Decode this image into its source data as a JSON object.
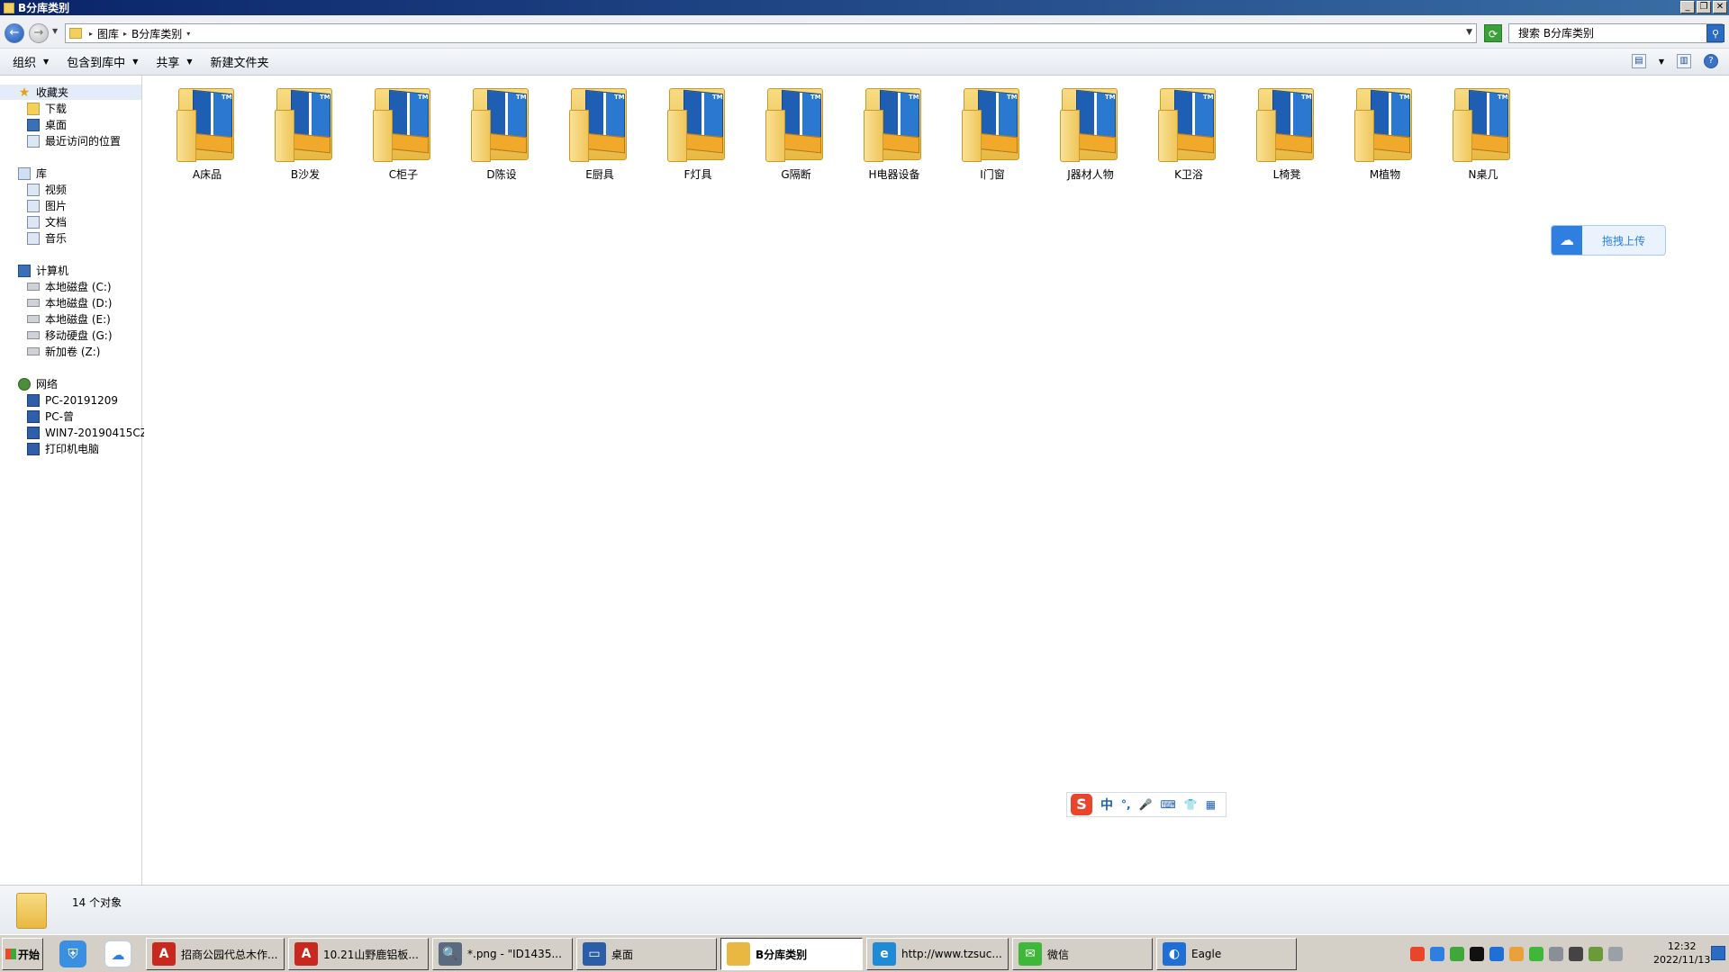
{
  "window": {
    "title": "B分库类别"
  },
  "address": {
    "crumbs": [
      "图库",
      "B分库类别"
    ],
    "search_placeholder": "搜索 B分库类别"
  },
  "toolbar": {
    "organize": "组织",
    "include_in_library": "包含到库中",
    "share": "共享",
    "new_folder": "新建文件夹"
  },
  "nav": {
    "favorites": "收藏夹",
    "favorites_items": [
      "下载",
      "桌面",
      "最近访问的位置"
    ],
    "library": "库",
    "library_items": [
      "视频",
      "图片",
      "文档",
      "音乐"
    ],
    "computer": "计算机",
    "computer_items": [
      "本地磁盘 (C:)",
      "本地磁盘 (D:)",
      "本地磁盘 (E:)",
      "移动硬盘 (G:)",
      "新加卷 (Z:)"
    ],
    "network": "网络",
    "network_items": [
      "PC-20191209",
      "PC-曾",
      "WIN7-20190415CZ",
      "打印机电脑"
    ]
  },
  "folders": [
    "A床品",
    "B沙发",
    "C柜子",
    "D陈设",
    "E厨具",
    "F灯具",
    "G隔断",
    "H电器设备",
    "I门窗",
    "J器材人物",
    "K卫浴",
    "L椅凳",
    "M植物",
    "N桌几"
  ],
  "overlay": {
    "upload_label": "拖拽上传",
    "ime_items": [
      "中",
      "°,",
      "🎤",
      "⌨",
      "👕",
      "▦"
    ]
  },
  "details": {
    "count_text": "14 个对象"
  },
  "taskbar": {
    "start_label": "开始",
    "tasks": [
      {
        "label": "招商公园代总木作...",
        "color": "#c8281e",
        "glyph": "A"
      },
      {
        "label": "10.21山野鹿铝板...",
        "color": "#c8281e",
        "glyph": "A"
      },
      {
        "label": "*.png - \"ID1435...",
        "color": "#5a6b80",
        "glyph": "🔍"
      },
      {
        "label": "桌面",
        "color": "#2a5ea8",
        "glyph": "▭"
      },
      {
        "label": "B分库类别",
        "color": "#e8b842",
        "glyph": ""
      },
      {
        "label": "http://www.tzsuc...",
        "color": "#1f8ad6",
        "glyph": "e"
      },
      {
        "label": "微信",
        "color": "#3fb83a",
        "glyph": "✉"
      },
      {
        "label": "Eagle",
        "color": "#1f6fd6",
        "glyph": "◐"
      }
    ],
    "clock_time": "12:32",
    "clock_date": "2022/11/13"
  },
  "colors": {
    "titlebar": "#0a246a",
    "selection": "#e3ecf8",
    "folder": "#e8b842",
    "accent": "#2f7fe0"
  }
}
